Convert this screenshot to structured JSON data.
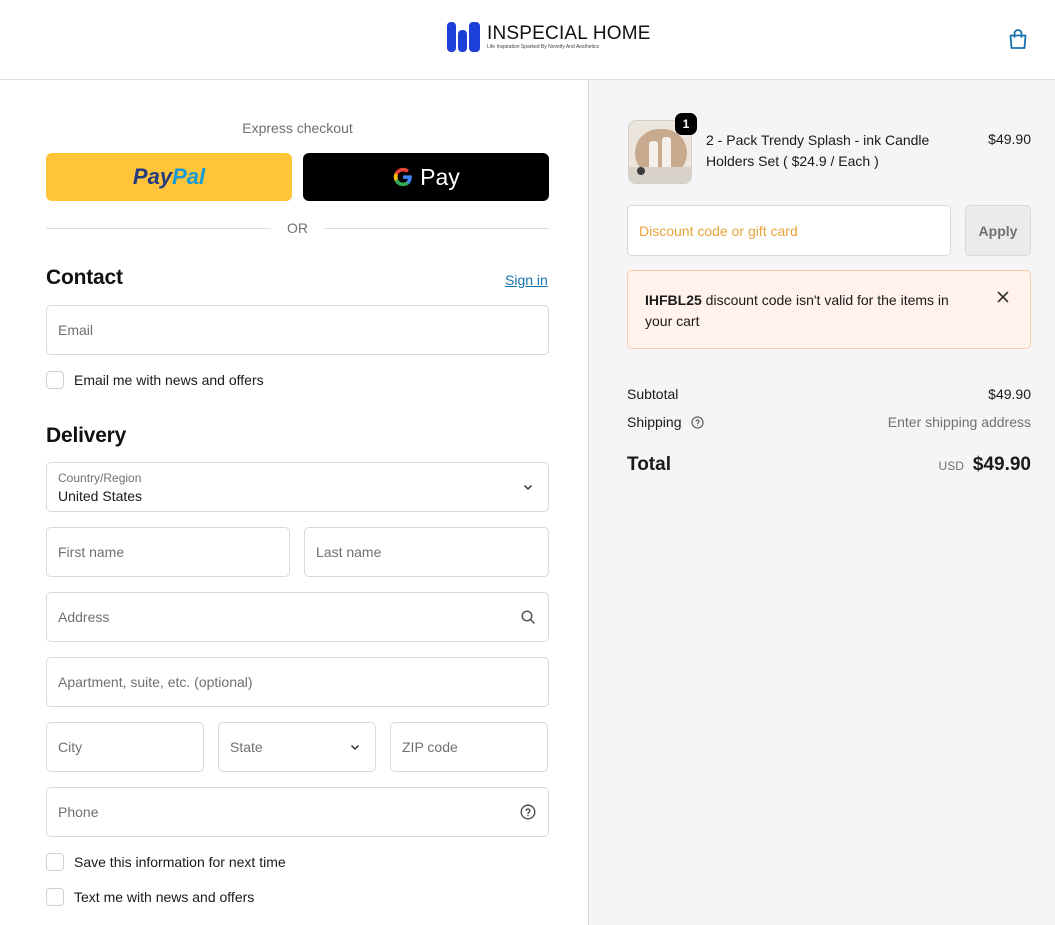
{
  "header": {
    "brand": "INSPECIAL HOME",
    "tagline": "Life Inspiration Sparked By Novelty And Aesthetics",
    "cart_icon": "shopping-bag-icon",
    "brand_color": "#1d3fd8"
  },
  "express": {
    "title": "Express checkout",
    "paypal_part1": "Pay",
    "paypal_part2": "Pal",
    "gpay_g": "G",
    "gpay_label": "Pay",
    "or_label": "OR"
  },
  "contact": {
    "title": "Contact",
    "sign_in": "Sign in",
    "email_placeholder": "Email",
    "news_label": "Email me with news and offers"
  },
  "delivery": {
    "title": "Delivery",
    "country_label": "Country/Region",
    "country_value": "United States",
    "first_name_placeholder": "First name",
    "last_name_placeholder": "Last name",
    "address_placeholder": "Address",
    "apartment_placeholder": "Apartment, suite, etc. (optional)",
    "city_placeholder": "City",
    "state_placeholder": "State",
    "zip_placeholder": "ZIP code",
    "phone_placeholder": "Phone",
    "save_info_label": "Save this information for next time",
    "text_me_label": "Text me with news and offers"
  },
  "summary": {
    "product": {
      "quantity": "1",
      "name": "2 - Pack Trendy Splash - ink Candle Holders Set ( $24.9 / Each )",
      "price": "$49.90"
    },
    "discount_placeholder": "Discount code or gift card",
    "apply_label": "Apply",
    "alert": {
      "code": "IHFBL25",
      "message": " discount code isn't valid for the items in your cart"
    },
    "subtotal_label": "Subtotal",
    "subtotal_value": "$49.90",
    "shipping_label": "Shipping",
    "shipping_value": "Enter shipping address",
    "total_label": "Total",
    "total_currency": "USD",
    "total_value": "$49.90"
  },
  "colors": {
    "paypal_yellow": "#ffc439",
    "link_blue": "#1773b0",
    "alert_bg": "#fff3ec",
    "placeholder_orange": "#e8a33a"
  }
}
